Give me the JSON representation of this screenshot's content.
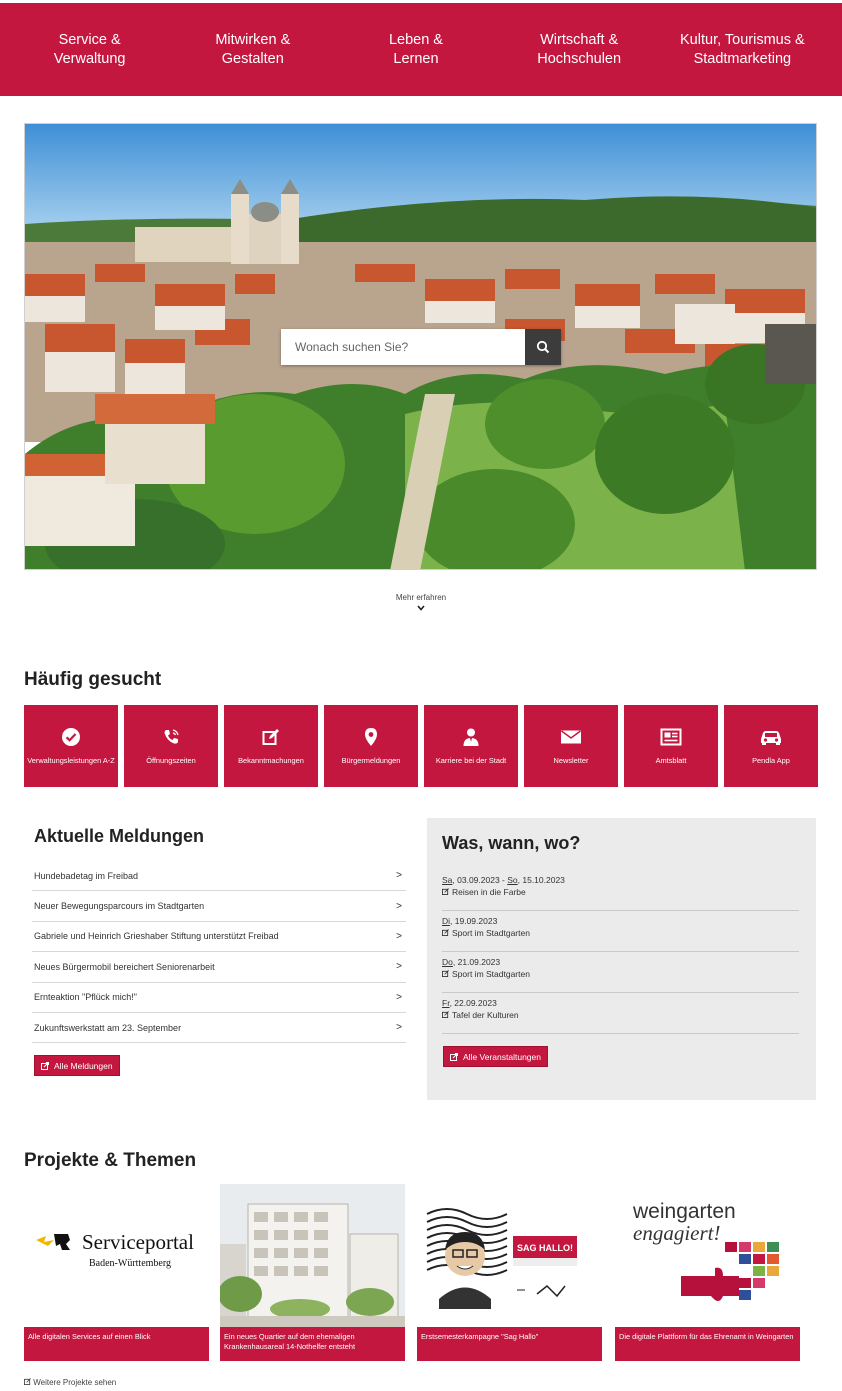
{
  "nav": {
    "items": [
      {
        "line1": "Service &",
        "line2": "Verwaltung"
      },
      {
        "line1": "Mitwirken &",
        "line2": "Gestalten"
      },
      {
        "line1": "Leben &",
        "line2": "Lernen"
      },
      {
        "line1": "Wirtschaft &",
        "line2": "Hochschulen"
      },
      {
        "line1": "Kultur, Tourismus &",
        "line2": "Stadtmarketing"
      }
    ]
  },
  "hero": {
    "search_placeholder": "Wonach suchen Sie?",
    "search_icon": "search-icon",
    "more_label": "Mehr erfahren"
  },
  "frequent": {
    "title": "Häufig gesucht",
    "tiles": [
      {
        "label": "Verwaltungsleistungen A-Z",
        "icon": "check-circle-icon"
      },
      {
        "label": "Öffnungszeiten",
        "icon": "phone-icon"
      },
      {
        "label": "Bekanntmachungen",
        "icon": "edit-icon"
      },
      {
        "label": "Bürgermeldungen",
        "icon": "map-pin-icon"
      },
      {
        "label": "Karriere bei der Stadt",
        "icon": "person-icon"
      },
      {
        "label": "Newsletter",
        "icon": "envelope-icon"
      },
      {
        "label": "Amtsblatt",
        "icon": "newspaper-icon"
      },
      {
        "label": "Pendla App",
        "icon": "car-icon"
      }
    ]
  },
  "news": {
    "title": "Aktuelle Meldungen",
    "items": [
      "Hundebadetag im Freibad",
      "Neuer Bewegungsparcours im Stadtgarten",
      "Gabriele und Heinrich Grieshaber Stiftung unterstützt Freibad",
      "Neues Bürgermobil bereichert Seniorenarbeit",
      "Ernteaktion \"Pflück mich!\"",
      "Zukunftswerkstatt am 23. September"
    ],
    "all_label": "Alle Meldungen"
  },
  "events": {
    "title": "Was, wann, wo?",
    "items": [
      {
        "wd1": "Sa",
        "date1": ", 03.09.2023",
        "sep": " - ",
        "wd2": "So",
        "date2": ", 15.10.2023",
        "title": "Reisen in die Farbe"
      },
      {
        "wd1": "Di",
        "date1": ", 19.09.2023",
        "title": "Sport im Stadtgarten"
      },
      {
        "wd1": "Do",
        "date1": ", 21.09.2023",
        "title": "Sport im Stadtgarten"
      },
      {
        "wd1": "Fr",
        "date1": ", 22.09.2023",
        "title": "Tafel der Kulturen"
      }
    ],
    "all_label": "Alle Veranstaltungen"
  },
  "projects": {
    "title": "Projekte & Themen",
    "cards": [
      {
        "caption": "Alle digitalen Services auf einen Blick",
        "logo_main": "Serviceportal",
        "logo_sub": "Baden-Württemberg"
      },
      {
        "caption": "Ein neues Quartier auf dem ehemaligen Krankenhausareal 14-Nothelfer entsteht"
      },
      {
        "caption": "Erstsemesterkampagne \"Sag Hallo\"",
        "badge": "SAG HALLO!"
      },
      {
        "caption": "Die digitale Plattform für das Ehrenamt in Weingarten",
        "logo_line1": "weingarten",
        "logo_line2": "engagiert!"
      }
    ],
    "more_label": "Weitere Projekte sehen"
  },
  "colors": {
    "brand": "#c4173f",
    "panel": "#ebebeb"
  }
}
